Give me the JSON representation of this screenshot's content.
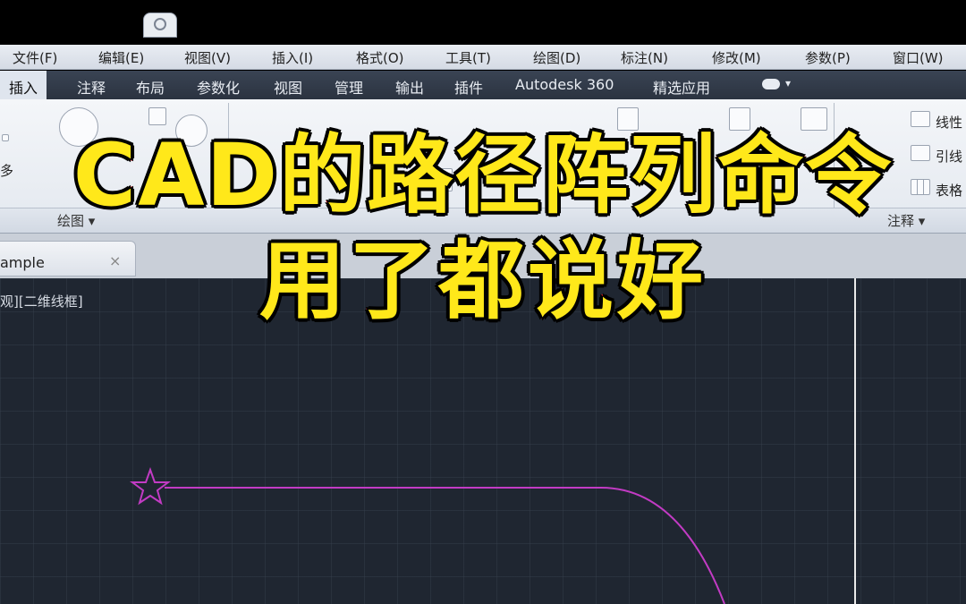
{
  "menu": [
    "文件(F)",
    "编辑(E)",
    "视图(V)",
    "插入(I)",
    "格式(O)",
    "工具(T)",
    "绘图(D)",
    "标注(N)",
    "修改(M)",
    "参数(P)",
    "窗口(W)"
  ],
  "ribbon_tabs": [
    "插入",
    "注释",
    "布局",
    "参数化",
    "视图",
    "管理",
    "输出",
    "插件",
    "Autodesk 360",
    "精选应用"
  ],
  "ribbon_panel": {
    "draw_title": "绘图 ▾",
    "annotate_title": "注释 ▾",
    "left_label": "多",
    "right_tools": [
      "线性",
      "引线",
      "表格"
    ]
  },
  "doc_tab": {
    "label": "ample",
    "close": "×"
  },
  "viewport": {
    "label": "观][二维线框]"
  },
  "overlay": {
    "line1": "CAD的路径阵列命令",
    "line2": "用了都说好"
  },
  "colors": {
    "path": "#c23bc4",
    "overlay_fill": "#ffe81a",
    "overlay_stroke": "#d01010",
    "canvas": "#1f2631"
  }
}
